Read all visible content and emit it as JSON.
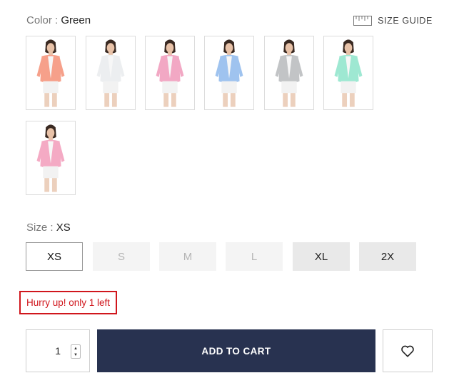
{
  "color": {
    "label": "Color :",
    "value": "Green"
  },
  "size_guide": {
    "label": "SIZE GUIDE",
    "icon": "ruler-icon"
  },
  "swatches": [
    {
      "name": "Coral",
      "color": "#f6a08a"
    },
    {
      "name": "White",
      "color": "#eceef0"
    },
    {
      "name": "Pink",
      "color": "#f2a8c4"
    },
    {
      "name": "Blue",
      "color": "#9fc3ef"
    },
    {
      "name": "Grey",
      "color": "#c2c4c6"
    },
    {
      "name": "Mint",
      "color": "#9ee8d2"
    },
    {
      "name": "Light Pink",
      "color": "#f4aac4"
    }
  ],
  "size": {
    "label": "Size :",
    "value": "XS"
  },
  "sizes": [
    {
      "label": "XS",
      "state": "selected"
    },
    {
      "label": "S",
      "state": "disabled"
    },
    {
      "label": "M",
      "state": "disabled"
    },
    {
      "label": "L",
      "state": "disabled"
    },
    {
      "label": "XL",
      "state": "available"
    },
    {
      "label": "2X",
      "state": "available"
    }
  ],
  "stock_notice": "Hurry up! only 1 left",
  "quantity": {
    "value": "1"
  },
  "add_to_cart": "ADD TO CART",
  "wishlist": {
    "icon": "heart-icon"
  },
  "colors": {
    "primary_button": "#283250",
    "alert": "#d0161c"
  }
}
